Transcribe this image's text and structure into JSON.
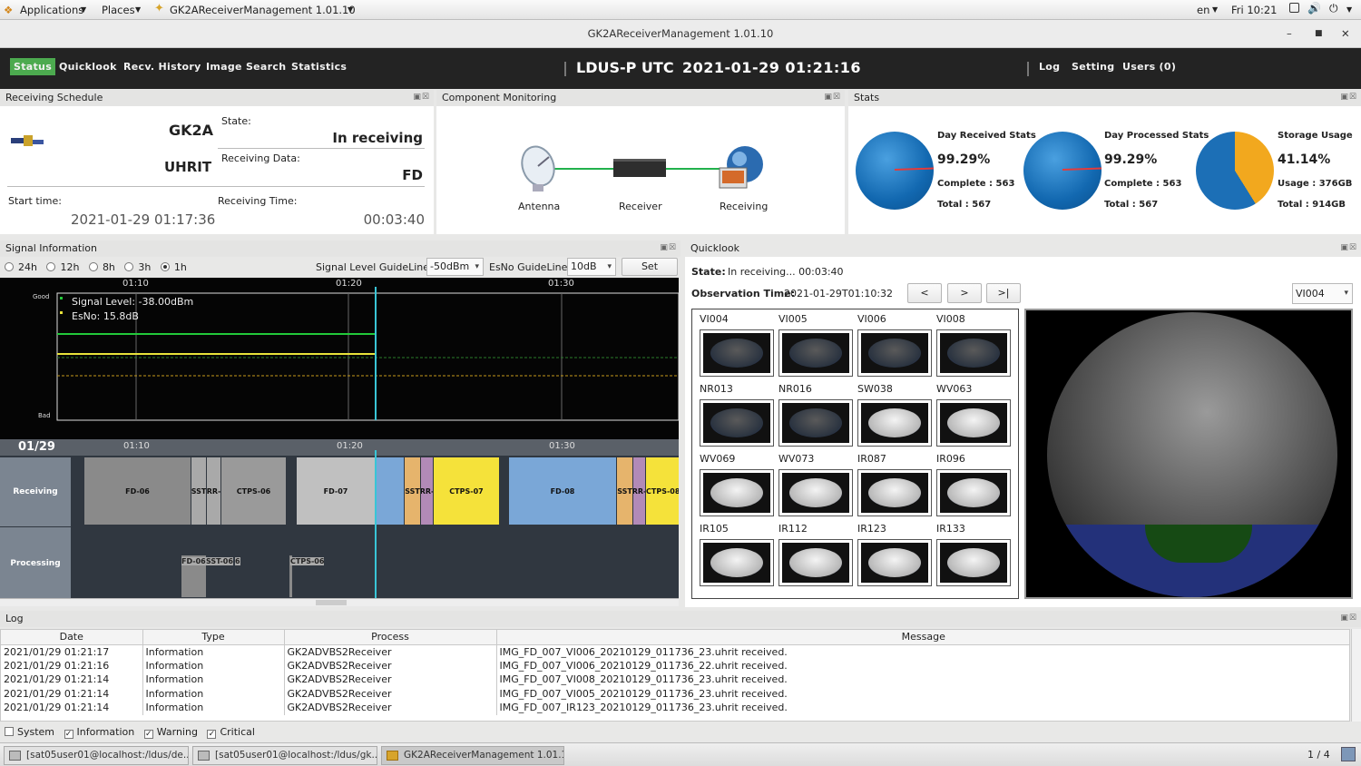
{
  "top_bar": {
    "applications": "Applications",
    "places": "Places",
    "window_app": "GK2AReceiverManagement 1.01.10",
    "lang": "en",
    "clock": "Fri 10:21"
  },
  "window": {
    "title": "GK2AReceiverManagement 1.01.10"
  },
  "nav": {
    "tabs": [
      "Status",
      "Quicklook",
      "Recv. History",
      "Image Search",
      "Statistics"
    ],
    "station": "LDUS-P UTC",
    "datetime": "2021-01-29 01:21:16",
    "right": [
      "Log",
      "Setting",
      "Users (0)"
    ]
  },
  "schedule": {
    "title": "Receiving Schedule",
    "satellite": "GK2A",
    "mode": "UHRIT",
    "state_label": "State:",
    "state_value": "In receiving",
    "data_label": "Receiving Data:",
    "data_value": "FD",
    "start_label": "Start time:",
    "start_value": "2021-01-29 01:17:36",
    "recv_label": "Receiving Time:",
    "recv_value": "00:03:40"
  },
  "components": {
    "title": "Component Monitoring",
    "items": [
      "Antenna",
      "Receiver",
      "Receiving"
    ],
    "link_color": "#22b14c"
  },
  "stats": {
    "title": "Stats",
    "items": [
      {
        "title": "Day Received Stats",
        "percent": "99.29%",
        "line1": "Complete : 563",
        "line2": "Total : 567"
      },
      {
        "title": "Day Processed Stats",
        "percent": "99.29%",
        "line1": "Complete : 563",
        "line2": "Total : 567"
      },
      {
        "title": "Storage Usage",
        "percent": "41.14%",
        "line1": "Usage : 376GB",
        "line2": "Total : 914GB"
      }
    ]
  },
  "signal": {
    "title": "Signal Information",
    "ranges": [
      "24h",
      "12h",
      "8h",
      "3h",
      "1h"
    ],
    "selected_range": "1h",
    "level_label": "Signal Level GuideLine",
    "level_value": "-50dBm",
    "esno_label": "EsNo GuideLine",
    "esno_value": "10dB",
    "set": "Set",
    "y_good": "Good",
    "y_bad": "Bad",
    "ticks": [
      "01:10",
      "01:20",
      "01:30"
    ],
    "legend": [
      "Signal Level: -38.00dBm",
      "EsNo: 15.8dB"
    ],
    "colors": {
      "signal": "#22c93a",
      "esno": "#e8e23a",
      "guide": "#c79a1a",
      "cursor": "#39c5d6"
    }
  },
  "timeline": {
    "date": "01/29",
    "ticks": [
      "01:10",
      "01:20",
      "01:30"
    ],
    "rows": [
      "Receiving",
      "Processing"
    ],
    "receiving": [
      {
        "label": "FD-06",
        "color": "#8a8a8a"
      },
      {
        "label": "SST",
        "color": "#a9a9a9"
      },
      {
        "label": "RR-",
        "color": "#a9a9a9"
      },
      {
        "label": "CTPS-06",
        "color": "#9a9a9a"
      },
      {
        "label": "FD-07",
        "color": "#c0c0c0"
      },
      {
        "label": "",
        "color": "#7aa7d7"
      },
      {
        "label": "SST",
        "color": "#e6b46c"
      },
      {
        "label": "RR-",
        "color": "#b28ab7"
      },
      {
        "label": "CTPS-07",
        "color": "#f5e23a"
      },
      {
        "label": "FD-08",
        "color": "#7aa7d7"
      },
      {
        "label": "SST",
        "color": "#e6b46c"
      },
      {
        "label": "RR-",
        "color": "#b28ab7"
      },
      {
        "label": "CTPS-08",
        "color": "#f5e23a"
      }
    ],
    "processing": [
      "FD-06",
      "SST-06",
      "6",
      "CTPS-06"
    ]
  },
  "quicklook": {
    "title": "Quicklook",
    "state_label": "State:",
    "state_value": "In receiving... 00:03:40",
    "obs_label": "Observation Time:",
    "obs_value": "2021-01-29T01:10:32",
    "prev": "<",
    "next": ">",
    "last": ">|",
    "channel": "VI004",
    "channels": [
      "VI004",
      "VI005",
      "VI006",
      "VI008",
      "NR013",
      "NR016",
      "SW038",
      "WV063",
      "WV069",
      "WV073",
      "IR087",
      "IR096",
      "IR105",
      "IR112",
      "IR123",
      "IR133"
    ]
  },
  "log": {
    "title": "Log",
    "columns": [
      "Date",
      "Type",
      "Process",
      "Message"
    ],
    "rows": [
      [
        "2021/01/29 01:21:17",
        "Information",
        "GK2ADVBS2Receiver",
        "IMG_FD_007_VI006_20210129_011736_23.uhrit received."
      ],
      [
        "2021/01/29 01:21:16",
        "Information",
        "GK2ADVBS2Receiver",
        "IMG_FD_007_VI006_20210129_011736_22.uhrit received."
      ],
      [
        "2021/01/29 01:21:14",
        "Information",
        "GK2ADVBS2Receiver",
        "IMG_FD_007_VI008_20210129_011736_23.uhrit received."
      ],
      [
        "2021/01/29 01:21:14",
        "Information",
        "GK2ADVBS2Receiver",
        "IMG_FD_007_VI005_20210129_011736_23.uhrit received."
      ],
      [
        "2021/01/29 01:21:14",
        "Information",
        "GK2ADVBS2Receiver",
        "IMG_FD_007_IR123_20210129_011736_23.uhrit received."
      ]
    ],
    "filters": [
      {
        "label": "System",
        "checked": false
      },
      {
        "label": "Information",
        "checked": true
      },
      {
        "label": "Warning",
        "checked": true
      },
      {
        "label": "Critical",
        "checked": true
      }
    ]
  },
  "taskbar": {
    "tasks": [
      "[sat05user01@localhost:/ldus/de...",
      "[sat05user01@localhost:/ldus/gk...",
      "GK2AReceiverManagement 1.01.10"
    ],
    "pager": "1 / 4"
  }
}
